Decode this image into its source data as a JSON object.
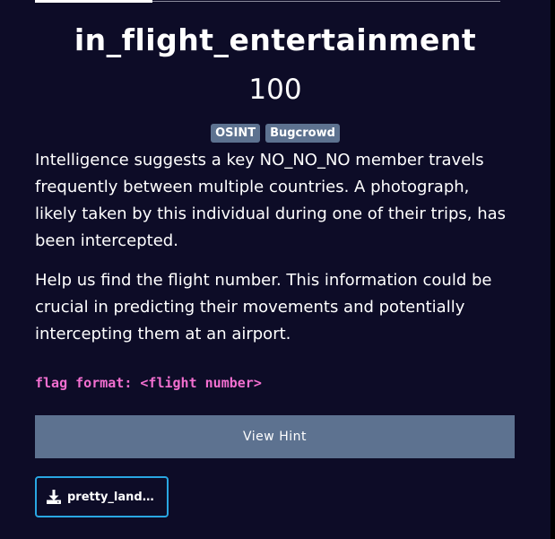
{
  "challenge": {
    "title": "in_flight_entertainment",
    "points": "100",
    "tags": [
      "OSINT",
      "Bugcrowd"
    ],
    "description": [
      "Intelligence suggests a key NO_NO_NO member travels frequently between multiple countries. A photograph, likely taken by this individual during one of their trips, has been intercepted.",
      "Help us find the flight number. This information could be crucial in predicting their movements and potentially intercepting them at an airport."
    ],
    "flag_format": "flag format: <flight number>"
  },
  "hint_button": {
    "label": "View Hint"
  },
  "files": [
    {
      "name": "pretty_land…",
      "icon": "download-icon"
    }
  ],
  "colors": {
    "background": "#0d0c27",
    "tag": "#5d7290",
    "hint_button": "#5d7290",
    "flag_format": "#f26fd0",
    "file_border": "#29a6e2"
  }
}
